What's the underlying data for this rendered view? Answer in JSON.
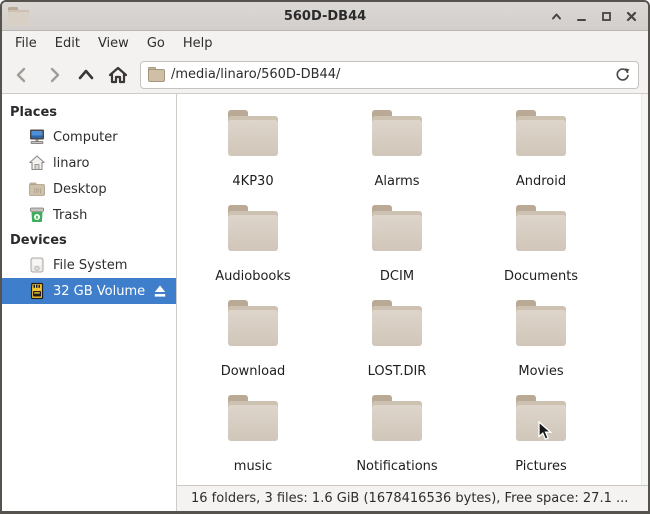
{
  "window": {
    "title": "560D-DB44",
    "app_icon": "folder-icon",
    "controls": [
      {
        "name": "shade-button",
        "icon": "chevron-up-icon"
      },
      {
        "name": "minimize-button",
        "icon": "minimize-icon"
      },
      {
        "name": "maximize-button",
        "icon": "maximize-icon"
      },
      {
        "name": "close-button",
        "icon": "close-icon"
      }
    ]
  },
  "menu": {
    "items": [
      "File",
      "Edit",
      "View",
      "Go",
      "Help"
    ]
  },
  "toolbar": {
    "buttons": [
      {
        "name": "back-button",
        "icon": "chevron-left-icon",
        "enabled": false
      },
      {
        "name": "forward-button",
        "icon": "chevron-right-icon",
        "enabled": false
      },
      {
        "name": "up-button",
        "icon": "chevron-up-icon",
        "enabled": true
      },
      {
        "name": "home-button",
        "icon": "home-icon",
        "enabled": true
      }
    ],
    "path_value": "/media/linaro/560D-DB44/",
    "path_icon": "folder-icon",
    "refresh_icon": "refresh-icon"
  },
  "sidebar": {
    "sections": [
      {
        "header": "Places",
        "items": [
          {
            "label": "Computer",
            "icon": "computer-icon",
            "selected": false,
            "eject": false
          },
          {
            "label": "linaro",
            "icon": "home-icon",
            "selected": false,
            "eject": false
          },
          {
            "label": "Desktop",
            "icon": "desktop-folder-icon",
            "selected": false,
            "eject": false
          },
          {
            "label": "Trash",
            "icon": "trash-icon",
            "selected": false,
            "eject": false
          }
        ]
      },
      {
        "header": "Devices",
        "items": [
          {
            "label": "File System",
            "icon": "harddrive-icon",
            "selected": false,
            "eject": false
          },
          {
            "label": "32 GB Volume",
            "icon": "sdcard-icon",
            "selected": true,
            "eject": true
          }
        ]
      }
    ]
  },
  "files": {
    "icon": "folder-icon",
    "folders": [
      "4KP30",
      "Alarms",
      "Android",
      "Audiobooks",
      "DCIM",
      "Documents",
      "Download",
      "LOST.DIR",
      "Movies",
      "music",
      "Notifications",
      "Pictures"
    ]
  },
  "statusbar": {
    "text": "16 folders, 3 files: 1.6 GiB (1678416536 bytes), Free space: 27.1 ..."
  },
  "colors": {
    "selection_blue": "#3e7ecb",
    "folder_body": "#d9d0c5",
    "folder_tab": "#b9a995",
    "titlebar_bg": "#d7d3d0",
    "chrome_bg": "#f4f2f0",
    "trash_green": "#3fae5c",
    "sdcard_yellow": "#f2c230"
  }
}
